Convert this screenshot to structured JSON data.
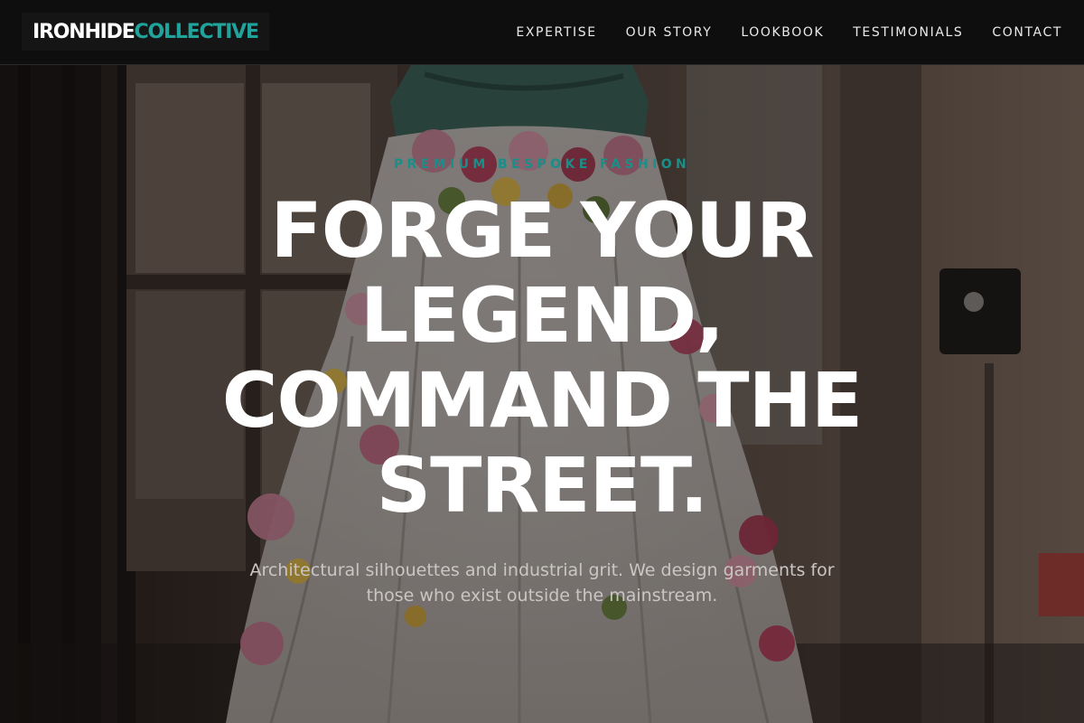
{
  "nav": {
    "logo": {
      "part_a": "IRONHIDE",
      "part_b": "COLLECTIVE"
    },
    "links": [
      {
        "label": "EXPERTISE"
      },
      {
        "label": "OUR STORY"
      },
      {
        "label": "LOOKBOOK"
      },
      {
        "label": "TESTIMONIALS"
      },
      {
        "label": "CONTACT"
      }
    ]
  },
  "hero": {
    "eyebrow": "PREMIUM BESPOKE FASHION",
    "headline": "FORGE YOUR LEGEND, COMMAND THE STREET.",
    "subtext": "Architectural silhouettes and industrial grit. We design garments for those who exist outside the mainstream.",
    "background": "floral-dress-mannequin-photo"
  },
  "colors": {
    "accent": "#1fa39b",
    "nav_background": "#0e0e0e",
    "headline": "#ffffff"
  }
}
